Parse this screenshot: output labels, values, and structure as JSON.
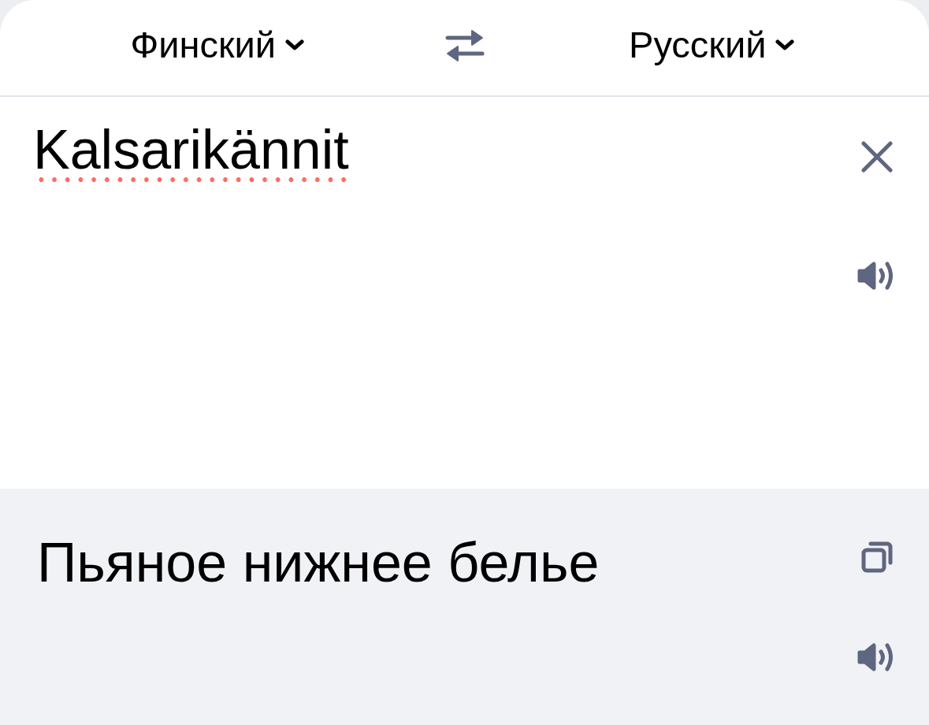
{
  "language_bar": {
    "source_language": "Финский",
    "target_language": "Русский"
  },
  "source": {
    "text": "Kalsarikännit",
    "misspelled": true
  },
  "translation": {
    "text": "Пьяное нижнее белье"
  }
}
